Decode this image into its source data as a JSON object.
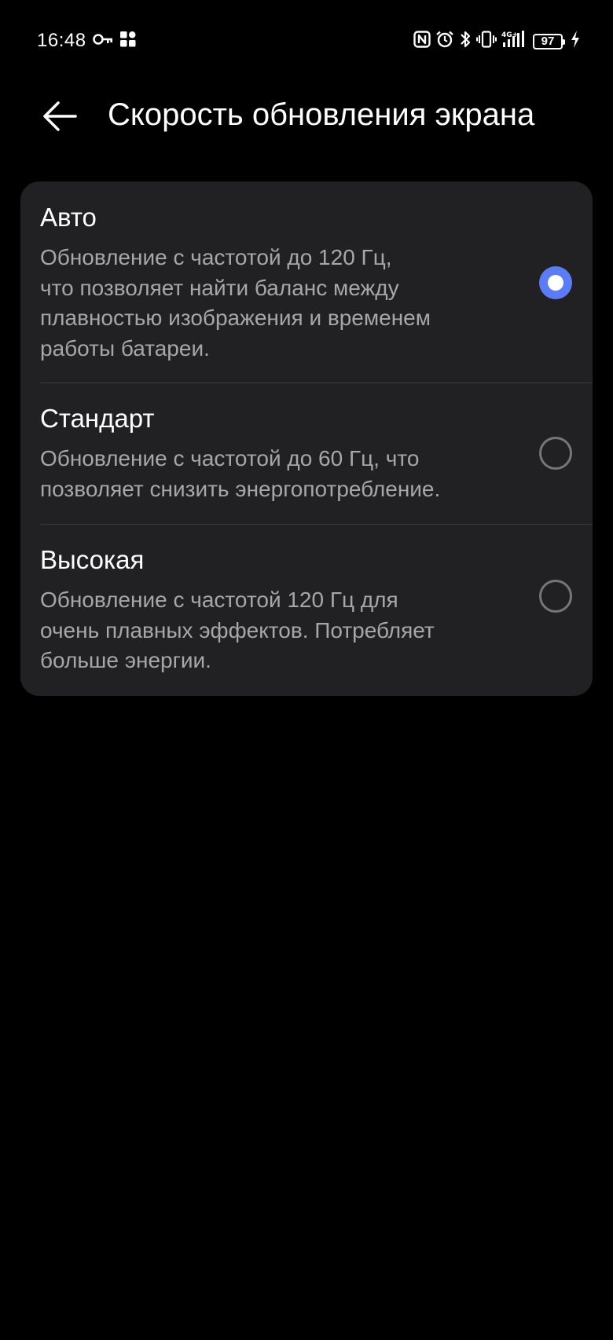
{
  "status_bar": {
    "time": "16:48",
    "left_icons": [
      "key-icon",
      "apps-grid-icon"
    ],
    "right_icons": [
      "nfc-icon",
      "alarm-icon",
      "bluetooth-icon",
      "vibrate-icon",
      "signal-4g-icon"
    ],
    "network": "4G+",
    "battery": "97"
  },
  "header": {
    "back_icon": "arrow-left-icon",
    "title": "Скорость обновления экрана"
  },
  "options": [
    {
      "title": "Авто",
      "description": "Обновление с частотой до 120 Гц,\nчто позволяет найти баланс между\nплавностью изображения и временем\nработы батареи.",
      "selected": true
    },
    {
      "title": "Стандарт",
      "description": "Обновление с частотой до 60 Гц, что\nпозволяет снизить энергопотребление.",
      "selected": false
    },
    {
      "title": "Высокая",
      "description": "Обновление с частотой 120 Гц для\nочень плавных эффектов. Потребляет\nбольше энергии.",
      "selected": false
    }
  ],
  "colors": {
    "background": "#000000",
    "card": "#212123",
    "accent": "#5b7cf7",
    "secondary_text": "#a7a7aa"
  }
}
